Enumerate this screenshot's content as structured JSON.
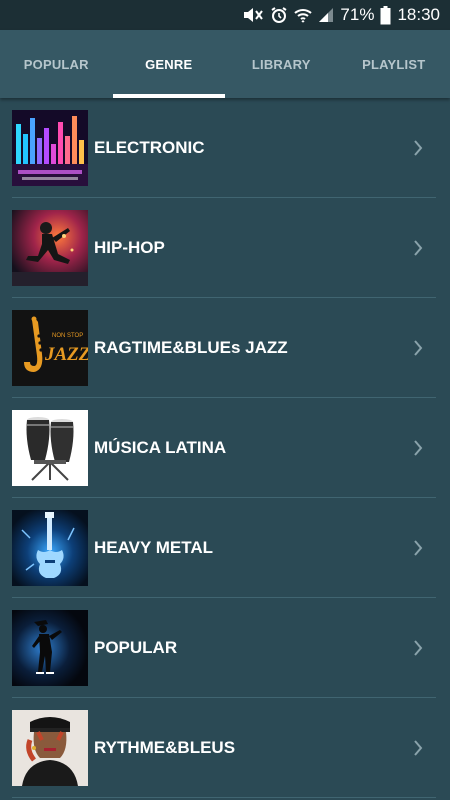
{
  "status_bar": {
    "battery_percent": "71%",
    "time": "18:30",
    "icons": [
      "mute-icon",
      "alarm-icon",
      "wifi-icon",
      "signal-icon",
      "battery-icon"
    ]
  },
  "tabs": [
    {
      "label": "POPULAR",
      "active": false
    },
    {
      "label": "GENRE",
      "active": true
    },
    {
      "label": "LIBRARY",
      "active": false
    },
    {
      "label": "PLAYLIST",
      "active": false
    }
  ],
  "genres": [
    {
      "label": "ELECTRONIC",
      "thumb_icon": "equalizer-artwork"
    },
    {
      "label": "HIP-HOP",
      "thumb_icon": "breakdancer-artwork"
    },
    {
      "label": "RAGTIME&BLUEs JAZZ",
      "thumb_icon": "saxophone-artwork",
      "thumb_text": [
        "NON STOP",
        "JAZZ"
      ]
    },
    {
      "label": "MÚSICA LATINA",
      "thumb_icon": "conga-drums-artwork"
    },
    {
      "label": "HEAVY METAL",
      "thumb_icon": "electric-guitar-artwork"
    },
    {
      "label": "POPULAR",
      "thumb_icon": "dancer-silhouette-artwork"
    },
    {
      "label": "RYTHME&BLEUS",
      "thumb_icon": "singer-portrait-artwork"
    }
  ],
  "colors": {
    "background": "#2b4a55",
    "tab_bar": "#365864",
    "status_bar": "#1c2f35",
    "divider": "#406571",
    "active_indicator": "#ffffff"
  }
}
